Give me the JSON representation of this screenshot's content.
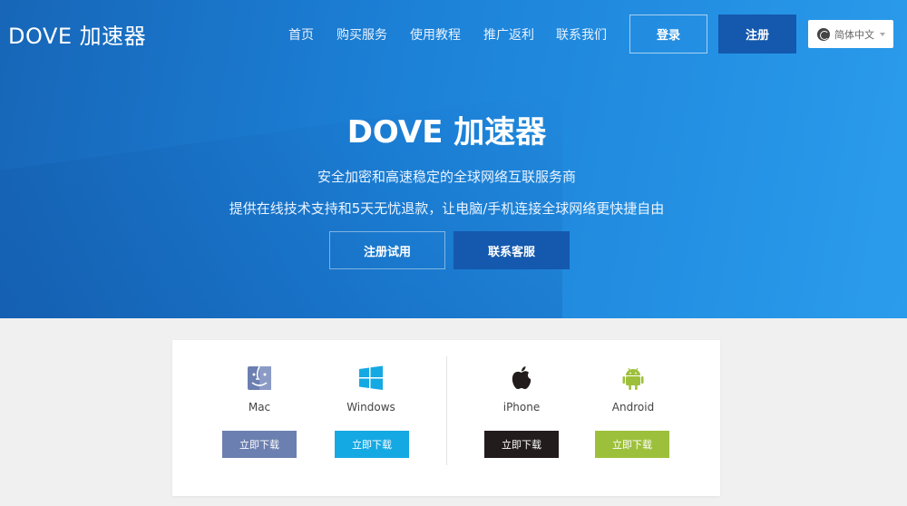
{
  "header": {
    "logo": "DOVE 加速器",
    "nav": [
      "首页",
      "购买服务",
      "使用教程",
      "推广返利",
      "联系我们"
    ],
    "login_label": "登录",
    "register_label": "注册",
    "language": "简体中文"
  },
  "hero": {
    "title": "DOVE 加速器",
    "subtitle1": "安全加密和高速稳定的全球网络互联服务商",
    "subtitle2": "提供在线技术支持和5天无忧退款，让电脑/手机连接全球网络更快捷自由",
    "trial_label": "注册试用",
    "support_label": "联系客服"
  },
  "downloads": {
    "button_label": "立即下载",
    "platforms": [
      {
        "name": "Mac",
        "icon": "finder-icon",
        "color": "#6b7fb0"
      },
      {
        "name": "Windows",
        "icon": "windows-icon",
        "color": "#15a9e4"
      },
      {
        "name": "iPhone",
        "icon": "apple-icon",
        "color": "#231c1c"
      },
      {
        "name": "Android",
        "icon": "android-icon",
        "color": "#9dc03c"
      }
    ]
  }
}
